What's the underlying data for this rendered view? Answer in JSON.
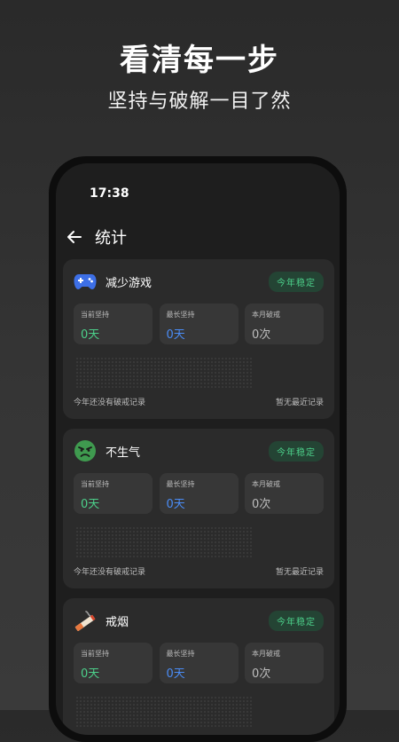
{
  "promo": {
    "title": "看清每一步",
    "subtitle": "坚持与破解一目了然"
  },
  "status_bar": {
    "time": "17:38"
  },
  "header": {
    "title": "统计"
  },
  "habits": [
    {
      "name": "减少游戏",
      "icon": "gamepad-icon",
      "badge": "今年稳定",
      "stats": [
        {
          "label": "当前坚持",
          "value": "0天"
        },
        {
          "label": "最长坚持",
          "value": "0天"
        },
        {
          "label": "本月破戒",
          "value": "0次"
        }
      ],
      "footer_left": "今年还没有破戒记录",
      "footer_right": "暂无最近记录"
    },
    {
      "name": "不生气",
      "icon": "angry-face-icon",
      "badge": "今年稳定",
      "stats": [
        {
          "label": "当前坚持",
          "value": "0天"
        },
        {
          "label": "最长坚持",
          "value": "0天"
        },
        {
          "label": "本月破戒",
          "value": "0次"
        }
      ],
      "footer_left": "今年还没有破戒记录",
      "footer_right": "暂无最近记录"
    },
    {
      "name": "戒烟",
      "icon": "cigarette-icon",
      "badge": "今年稳定",
      "stats": [
        {
          "label": "当前坚持",
          "value": "0天"
        },
        {
          "label": "最长坚持",
          "value": "0天"
        },
        {
          "label": "本月破戒",
          "value": "0次"
        }
      ],
      "footer_left": "",
      "footer_right": ""
    }
  ],
  "colors": {
    "accent_green": "#4cd08a",
    "accent_blue": "#4a8cf5",
    "card_bg": "#2b2b2b",
    "stat_bg": "#373737"
  }
}
